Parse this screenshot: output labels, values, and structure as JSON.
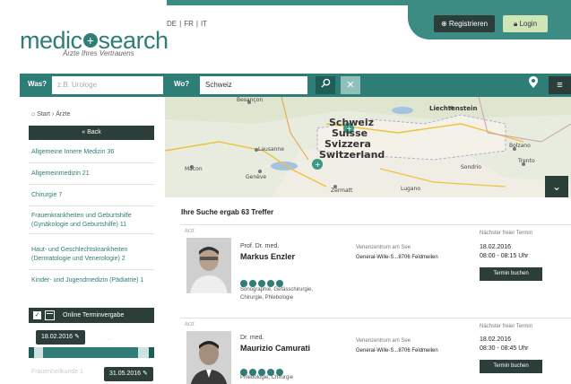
{
  "header": {
    "logo_text_1": "medic",
    "logo_plus": "+",
    "logo_text_2": "search",
    "tagline": "Ärzte Ihres Vertrauens",
    "languages": [
      "DE",
      "|",
      "FR",
      "|",
      "IT"
    ],
    "register_label": "Registrieren",
    "login_label": "Login"
  },
  "search": {
    "what_label": "Was?",
    "what_placeholder": "z.B. Urologe",
    "where_label": "Wo?",
    "where_value": "Schweiz",
    "search_icon": "magnifier-icon",
    "clear_icon": "close-icon",
    "location_icon": "map-pin-icon",
    "menu_icon": "hamburger-icon"
  },
  "sidebar": {
    "breadcrumb": "Start › Ärzte",
    "back_label": "« Back",
    "filters": [
      "Allgemeine Innere Medizin 36",
      "Allgemeinmedizin 21",
      "Chirurgie 7",
      "Frauenkrankheiten und Geburtshilfe (Gynäkologie und Geburtshilfe) 11",
      "Haut- und Geschlechtskrankheiten (Dermatologie und Venerologie) 2",
      "Kinder- und Jugendmedizin (Pädiatrie) 1"
    ],
    "online_booking_label": "Online Terminvergabe",
    "date_from": "18.02.2016",
    "date_to": "31.05.2016",
    "hidden_text": "…",
    "cut_item": "Frauenheilkunde 1"
  },
  "map": {
    "country_labels": [
      "Schweiz",
      "Suisse",
      "Svizzera",
      "Switzerland"
    ],
    "place_labels": [
      "Besançon",
      "Lausanne",
      "Genève",
      "Mâcon",
      "Liechtenstein",
      "Bolzano",
      "Trento",
      "Sondrio",
      "Zermatt",
      "Lugano"
    ],
    "toggle_icon": "chevron-down-icon"
  },
  "results": {
    "title": "Ihre Suche ergab 63 Treffer",
    "items": [
      {
        "type": "Arzt",
        "title": "Prof. Dr. med.",
        "name": "Markus Enzler",
        "stars": 5,
        "specialties": [
          "Sonographie, Gefässchirurgie,",
          "Chirurgie, Phlebologie"
        ],
        "practice": "Venenzentrum am See",
        "address": "General-Wille-S...8706 Feldmeilen",
        "next_label": "Nächster freier Termin",
        "date": "18.02.2016",
        "time": "08:00 - 08:15 Uhr",
        "book_label": "Termin buchen"
      },
      {
        "type": "Arzt",
        "title": "Dr. med.",
        "name": "Maurizio Camurati",
        "stars": 5,
        "specialties": [
          "Phlebologie, Chirurgie"
        ],
        "practice": "Venenzentrum am See",
        "address": "General-Wille-S...8706 Feldmeilen",
        "next_label": "Nächster freier Termin",
        "date": "18.02.2016",
        "time": "08:30 - 08:45 Uhr",
        "book_label": "Termin buchen"
      }
    ]
  },
  "colors": {
    "brand_teal": "#2e7d76",
    "dark": "#2c3e3a",
    "login_green": "#cfe5b5"
  }
}
